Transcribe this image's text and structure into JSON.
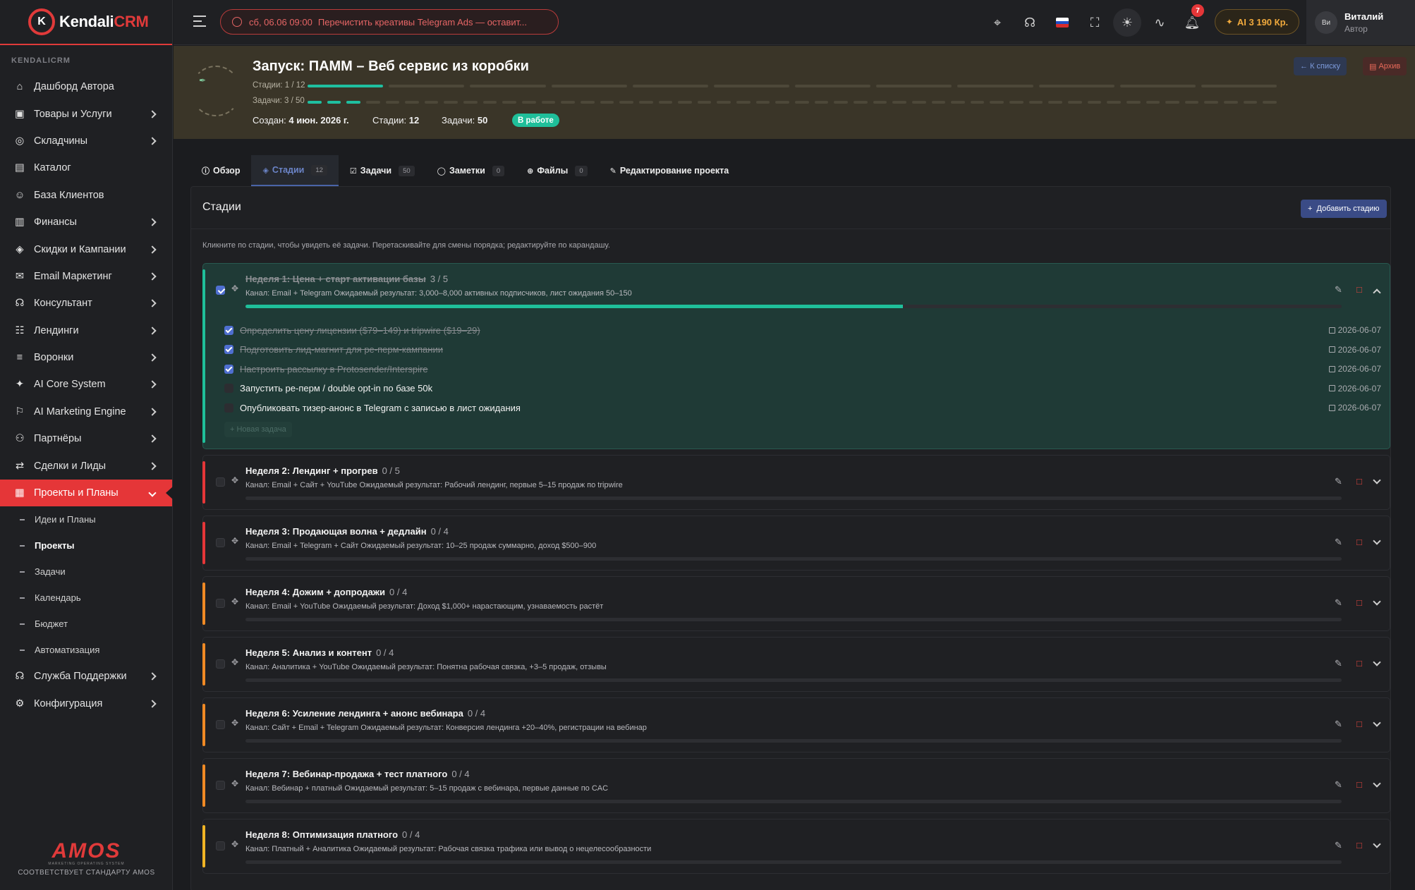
{
  "brand": {
    "name": "Kendali",
    "accent": "CRM",
    "logo_letter": "K",
    "accent_color": "#e03a3a"
  },
  "sidebar": {
    "section": "KENDALICRM",
    "items": [
      {
        "label": "Дашборд Автора",
        "icon": "home-icon",
        "chevron": false
      },
      {
        "label": "Товары и Услуги",
        "icon": "box-icon",
        "chevron": true
      },
      {
        "label": "Складчины",
        "icon": "globe-icon",
        "chevron": true
      },
      {
        "label": "Каталог",
        "icon": "archive-icon",
        "chevron": false
      },
      {
        "label": "База Клиентов",
        "icon": "user-icon",
        "chevron": false
      },
      {
        "label": "Финансы",
        "icon": "wallet-icon",
        "chevron": true
      },
      {
        "label": "Скидки и Кампании",
        "icon": "tag-icon",
        "chevron": true
      },
      {
        "label": "Email Маркетинг",
        "icon": "mail-icon",
        "chevron": true
      },
      {
        "label": "Консультант",
        "icon": "headset-icon",
        "chevron": true
      },
      {
        "label": "Лендинги",
        "icon": "page-icon",
        "chevron": true
      },
      {
        "label": "Воронки",
        "icon": "filter-icon",
        "chevron": true
      },
      {
        "label": "AI Core System",
        "icon": "sparkle-icon",
        "chevron": true
      },
      {
        "label": "AI Marketing Engine",
        "icon": "bell-icon",
        "chevron": true
      },
      {
        "label": "Партнёры",
        "icon": "people-icon",
        "chevron": true
      },
      {
        "label": "Сделки и Лиды",
        "icon": "handshake-icon",
        "chevron": true
      },
      {
        "label": "Проекты и Планы",
        "icon": "projects-icon",
        "chevron": true,
        "active": true
      }
    ],
    "subitems": [
      "Идеи и Планы",
      "Проекты",
      "Задачи",
      "Календарь",
      "Бюджет",
      "Автоматизация"
    ],
    "current_sub": "Проекты",
    "bottom_items": [
      {
        "label": "Служба Поддержки",
        "icon": "headset-icon",
        "chevron": true
      },
      {
        "label": "Конфигурация",
        "icon": "gear-icon",
        "chevron": true
      }
    ],
    "footer": {
      "logo": "AMOS",
      "tagline": "MARKETING OPERATING SYSTEM",
      "standard": "СООТВЕТСТВУЕТ СТАНДАРТУ AMOS"
    }
  },
  "topbar": {
    "reminder_time": "сб, 06.06 09:00",
    "reminder_text": "Перечистить креативы Telegram Ads — оставит...",
    "notif_count": "7",
    "ai_label": "AI",
    "ai_balance": "3 190",
    "ai_currency": "Кр.",
    "user_name": "Виталий",
    "user_role": "Автор",
    "avatar_alt": "Ви"
  },
  "project": {
    "title": "Запуск: ПАММ – Веб сервис из коробки",
    "stages_progress_label": "Стадии: 1 / 12",
    "stages_done": 1,
    "stages_total": 12,
    "tasks_progress_label": "Задачи: 3 / 50",
    "tasks_done": 3,
    "tasks_total": 50,
    "created_label": "Создан:",
    "created_value": "4 июн. 2026 г.",
    "stages_label": "Стадии:",
    "stages_value": "12",
    "tasks_label": "Задачи:",
    "tasks_value": "50",
    "status": "В работе",
    "btn_list": "К списку",
    "btn_archive": "Архив"
  },
  "tabs": [
    {
      "label": "Обзор",
      "icon": "info-icon",
      "count": ""
    },
    {
      "label": "Стадии",
      "icon": "layers-icon",
      "count": "12",
      "active": true
    },
    {
      "label": "Задачи",
      "icon": "checkbox-icon",
      "count": "50"
    },
    {
      "label": "Заметки",
      "icon": "chat-icon",
      "count": "0"
    },
    {
      "label": "Файлы",
      "icon": "clip-icon",
      "count": "0"
    },
    {
      "label": "Редактирование проекта",
      "icon": "pencil-icon",
      "count": ""
    }
  ],
  "stages_panel": {
    "title": "Стадии",
    "add_button": "Добавить стадию",
    "hint": "Кликните по стадии, чтобы увидеть её задачи. Перетаскивайте для смены порядка; редактируйте по карандашу."
  },
  "stages": [
    {
      "name": "Неделя 1: Цена + старт активации базы",
      "count": "3 / 5",
      "done": true,
      "open": true,
      "progress": 0.6,
      "color": "#1fbf9a",
      "desc": "Канал: Email + Telegram Ожидаемый результат: 3,000–8,000 активных подписчиков, лист ожидания 50–150",
      "tasks": [
        {
          "text": "Определить цену лицензии ($79–149) и tripwire ($19–29)",
          "done": true,
          "date": "2026-06-07"
        },
        {
          "text": "Подготовить лид-магнит для ре-перм-кампании",
          "done": true,
          "date": "2026-06-07"
        },
        {
          "text": "Настроить рассылку в Protosender/Interspire",
          "done": true,
          "date": "2026-06-07"
        },
        {
          "text": "Запустить ре-перм / double opt-in по базе 50k",
          "done": false,
          "date": "2026-06-07"
        },
        {
          "text": "Опубликовать тизер-анонс в Telegram с записью в лист ожидания",
          "done": false,
          "date": "2026-06-07"
        }
      ],
      "new_task": "+ Новая задача"
    },
    {
      "name": "Неделя 2: Лендинг + прогрев",
      "count": "0 / 5",
      "done": false,
      "progress": 0,
      "color": "#e53638",
      "desc": "Канал: Email + Сайт + YouTube Ожидаемый результат: Рабочий лендинг, первые 5–15 продаж по tripwire"
    },
    {
      "name": "Неделя 3: Продающая волна + дедлайн",
      "count": "0 / 4",
      "done": false,
      "progress": 0,
      "color": "#e53638",
      "desc": "Канал: Email + Telegram + Сайт Ожидаемый результат: 10–25 продаж суммарно, доход $500–900"
    },
    {
      "name": "Неделя 4: Дожим + допродажи",
      "count": "0 / 4",
      "done": false,
      "progress": 0,
      "color": "#f08a24",
      "desc": "Канал: Email + YouTube Ожидаемый результат: Доход $1,000+ нарастающим, узнаваемость растёт"
    },
    {
      "name": "Неделя 5: Анализ и контент",
      "count": "0 / 4",
      "done": false,
      "progress": 0,
      "color": "#f08a24",
      "desc": "Канал: Аналитика + YouTube Ожидаемый результат: Понятна рабочая связка, +3–5 продаж, отзывы"
    },
    {
      "name": "Неделя 6: Усиление лендинга + анонс вебинара",
      "count": "0 / 4",
      "done": false,
      "progress": 0,
      "color": "#f08a24",
      "desc": "Канал: Сайт + Email + Telegram Ожидаемый результат: Конверсия лендинга +20–40%, регистрации на вебинар"
    },
    {
      "name": "Неделя 7: Вебинар-продажа + тест платного",
      "count": "0 / 4",
      "done": false,
      "progress": 0,
      "color": "#f08a24",
      "desc": "Канал: Вебинар + платный Ожидаемый результат: 5–15 продаж с вебинара, первые данные по CAC"
    },
    {
      "name": "Неделя 8: Оптимизация платного",
      "count": "0 / 4",
      "done": false,
      "progress": 0,
      "color": "#f0b424",
      "desc": "Канал: Платный + Аналитика Ожидаемый результат: Рабочая связка трафика или вывод о нецелесообразности"
    }
  ]
}
